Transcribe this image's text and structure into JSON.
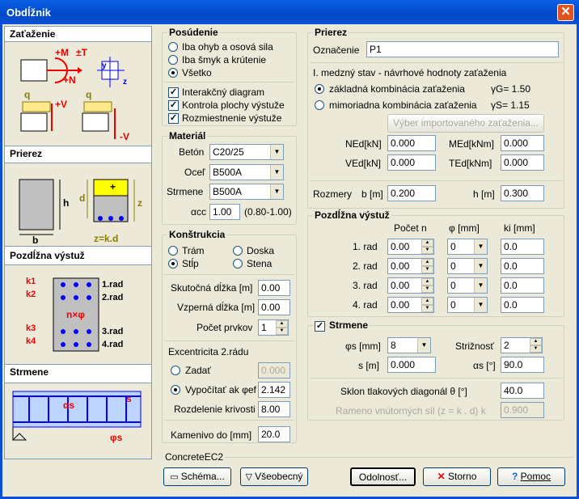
{
  "window": {
    "title": "Obdĺžnik",
    "close_icon": "close-icon"
  },
  "left_panel": {
    "zatazenie": "Zaťaženie",
    "z_labels": {
      "m": "+M",
      "t": "±T",
      "n": "+N",
      "y": "y",
      "z": "z",
      "q1": "q",
      "v1": "+V",
      "q2": "q",
      "v2": "-V"
    },
    "prierez": "Prierez",
    "p_labels": {
      "h": "h",
      "b": "b",
      "d": "d",
      "z": "z",
      "zkd": "z=k.d",
      "plus": "+"
    },
    "vystuz": "Pozdĺžna výstuž",
    "v_labels": {
      "k1": "k1",
      "k2": "k2",
      "k3": "k3",
      "k4": "k4",
      "r1": "1.rad",
      "r2": "2.rad",
      "r3": "3.rad",
      "r4": "4.rad",
      "nphi": "n×φ"
    },
    "strmene": "Strmene",
    "s_labels": {
      "alpha": "αs",
      "s": "s",
      "phi": "φs"
    }
  },
  "posudenie": {
    "title": "Posúdenie",
    "options": [
      "Iba ohyb a osová sila",
      "Iba šmyk a krútenie",
      "Všetko"
    ],
    "checks": [
      "Interakčný diagram",
      "Kontrola plochy výstuže",
      "Rozmiestnenie výstuže"
    ]
  },
  "material": {
    "title": "Materiál",
    "beton_label": "Betón",
    "beton": "C20/25",
    "ocel_label": "Oceľ",
    "ocel": "B500A",
    "strmene_label": "Strmene",
    "strmene": "B500A",
    "acc_label": "αcc",
    "acc": "1.00",
    "acc_range": "(0.80-1.00)"
  },
  "konstrukcia": {
    "title": "Konštrukcia",
    "options": [
      "Trám",
      "Doska",
      "Stĺp",
      "Stena"
    ],
    "skut_label": "Skutočná dĺžka [m]",
    "skut": "0.00",
    "vzper_label": "Vzperná dĺžka [m]",
    "vzper": "0.00",
    "pocet_label": "Počet prvkov",
    "pocet": "1",
    "exc_label": "Excentricita 2.rádu",
    "zadat_label": "Zadať",
    "zadat": "0.000",
    "vyp_label": "Vypočítať ak φef",
    "vyp": "2.142",
    "rozd_label": "Rozdelenie krivosti",
    "rozd": "8.00",
    "kam_label": "Kamenivo do [mm]",
    "kam": "20.0"
  },
  "prierez": {
    "title": "Prierez",
    "oznacenie_label": "Označenie",
    "oznacenie": "P1",
    "mst_title": "I. medzný stav - návrhové hodnoty zaťaženia",
    "zakladna": "základná kombinácia zaťaženia",
    "zakladna_g": "γG= 1.50",
    "mimoriadna": "mimoriadna kombinácia zaťaženia",
    "mimoriadna_g": "γS= 1.15",
    "import_btn": "Výber importovaného zaťaženia...",
    "ned_label": "NEd[kN]",
    "ned": "0.000",
    "med_label": "MEd[kNm]",
    "med": "0.000",
    "ved_label": "VEd[kN]",
    "ved": "0.000",
    "ted_label": "TEd[kNm]",
    "ted": "0.000",
    "rozmery_label": "Rozmery",
    "b_label": "b [m]",
    "b": "0.200",
    "h_label": "h [m]",
    "h": "0.300"
  },
  "vystuz": {
    "title": "Pozdĺžna výstuž",
    "col_n": "Počet n",
    "col_phi": "φ [mm]",
    "col_k": "ki [mm]",
    "rows": [
      {
        "label": "1. rad",
        "n": "0.00",
        "phi": "0",
        "k": "0.0"
      },
      {
        "label": "2. rad",
        "n": "0.00",
        "phi": "0",
        "k": "0.0"
      },
      {
        "label": "3. rad",
        "n": "0.00",
        "phi": "0",
        "k": "0.0"
      },
      {
        "label": "4. rad",
        "n": "0.00",
        "phi": "0",
        "k": "0.0"
      }
    ]
  },
  "strmene": {
    "title": "Strmene",
    "phis_label": "φs [mm]",
    "phis": "8",
    "strih_label": "Strižnosť",
    "strih": "2",
    "s_label": "s [m]",
    "s": "0.000",
    "as_label": "αs [°]",
    "as": "90.0",
    "theta_label": "Sklon tlakových diagonál  θ [°]",
    "theta": "40.0",
    "rameno_label": "Rameno vnútorných síl  (z = k . d)    k",
    "rameno": "0.900"
  },
  "footer": {
    "group_label": "ConcreteEC2",
    "schema": "Schéma...",
    "vseobecny": "Všeobecný",
    "odolnost": "Odolnosť...",
    "storno": "Storno",
    "pomoc": "Pomoc"
  }
}
